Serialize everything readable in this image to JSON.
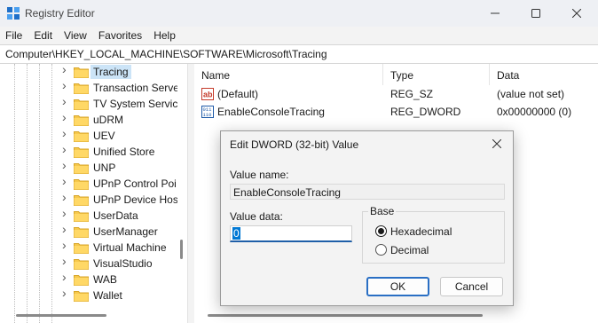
{
  "window": {
    "title": "Registry Editor"
  },
  "menu": [
    "File",
    "Edit",
    "View",
    "Favorites",
    "Help"
  ],
  "address": "Computer\\HKEY_LOCAL_MACHINE\\SOFTWARE\\Microsoft\\Tracing",
  "tree": {
    "items": [
      {
        "label": "Tracing",
        "selected": true
      },
      {
        "label": "Transaction Serve"
      },
      {
        "label": "TV System Service"
      },
      {
        "label": "uDRM"
      },
      {
        "label": "UEV"
      },
      {
        "label": "Unified Store"
      },
      {
        "label": "UNP"
      },
      {
        "label": "UPnP Control Poi"
      },
      {
        "label": "UPnP Device Hos"
      },
      {
        "label": "UserData"
      },
      {
        "label": "UserManager"
      },
      {
        "label": "Virtual Machine"
      },
      {
        "label": "VisualStudio"
      },
      {
        "label": "WAB"
      },
      {
        "label": "Wallet"
      }
    ]
  },
  "list": {
    "columns": [
      "Name",
      "Type",
      "Data"
    ],
    "rows": [
      {
        "name": "(Default)",
        "type": "REG_SZ",
        "data": "(value not set)",
        "icon": "string-value-icon"
      },
      {
        "name": "EnableConsoleTracing",
        "type": "REG_DWORD",
        "data": "0x00000000 (0)",
        "icon": "dword-value-icon"
      }
    ]
  },
  "dialog": {
    "title": "Edit DWORD (32-bit) Value",
    "value_name_label": "Value name:",
    "value_name": "EnableConsoleTracing",
    "value_data_label": "Value data:",
    "value_data": "0",
    "base_label": "Base",
    "base_options": [
      "Hexadecimal",
      "Decimal"
    ],
    "base_selected": "Hexadecimal",
    "ok": "OK",
    "cancel": "Cancel"
  }
}
